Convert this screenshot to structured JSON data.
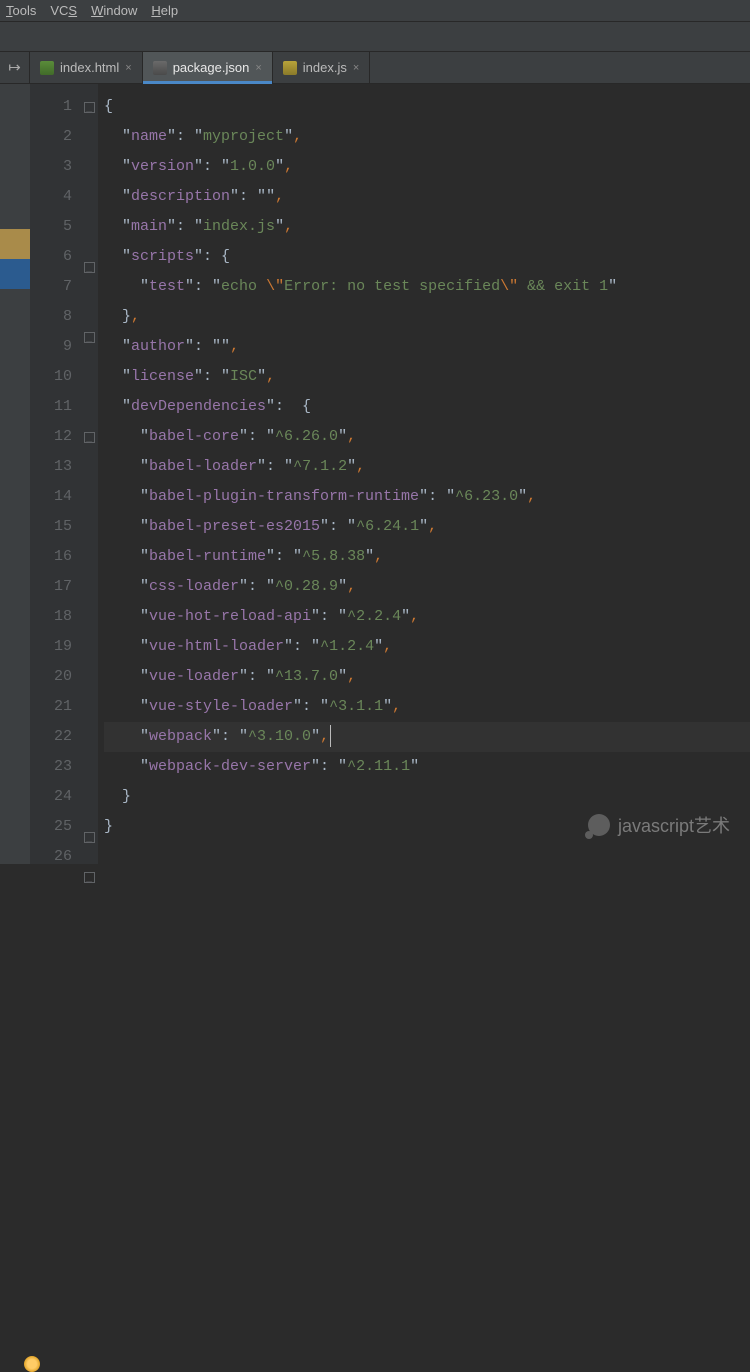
{
  "menu": {
    "items": [
      "Tools",
      "VCS",
      "Window",
      "Help"
    ],
    "underlines": [
      "T",
      "S",
      "W",
      "H"
    ]
  },
  "tabs": [
    {
      "label": "index.html",
      "icon": "html"
    },
    {
      "label": "package.json",
      "icon": "json",
      "active": true
    },
    {
      "label": "index.js",
      "icon": "js"
    }
  ],
  "close_glyph": "×",
  "back_glyph": "↦",
  "watermark": "javascript艺术",
  "code_lines": [
    {
      "n": 1,
      "tokens": [
        [
          "b",
          "{"
        ]
      ],
      "fold": "open"
    },
    {
      "n": 2,
      "tokens": [
        [
          "b",
          "  \""
        ],
        [
          "k",
          "name"
        ],
        [
          "b",
          "\": \""
        ],
        [
          "s",
          "myproject"
        ],
        [
          "b",
          "\""
        ],
        [
          "p",
          ","
        ]
      ]
    },
    {
      "n": 3,
      "tokens": [
        [
          "b",
          "  \""
        ],
        [
          "k",
          "version"
        ],
        [
          "b",
          "\": \""
        ],
        [
          "s",
          "1.0.0"
        ],
        [
          "b",
          "\""
        ],
        [
          "p",
          ","
        ]
      ]
    },
    {
      "n": 4,
      "tokens": [
        [
          "b",
          "  \""
        ],
        [
          "k",
          "description"
        ],
        [
          "b",
          "\": \""
        ],
        [
          "s",
          ""
        ],
        [
          "b",
          "\""
        ],
        [
          "p",
          ","
        ]
      ]
    },
    {
      "n": 5,
      "tokens": [
        [
          "b",
          "  \""
        ],
        [
          "k",
          "main"
        ],
        [
          "b",
          "\": \""
        ],
        [
          "s",
          "index.js"
        ],
        [
          "b",
          "\""
        ],
        [
          "p",
          ","
        ]
      ]
    },
    {
      "n": 6,
      "tokens": [
        [
          "b",
          "  \""
        ],
        [
          "k",
          "scripts"
        ],
        [
          "b",
          "\": {"
        ]
      ],
      "fold": "open"
    },
    {
      "n": 7,
      "tokens": [
        [
          "b",
          "    \""
        ],
        [
          "k",
          "test"
        ],
        [
          "b",
          "\": \""
        ],
        [
          "s",
          "echo "
        ],
        [
          "esc",
          "\\\""
        ],
        [
          "s",
          "Error: no test specified"
        ],
        [
          "esc",
          "\\\""
        ],
        [
          "s",
          " && exit 1"
        ],
        [
          "b",
          "\""
        ]
      ]
    },
    {
      "n": 8,
      "tokens": [
        [
          "b",
          "  }"
        ],
        [
          "p",
          ","
        ]
      ],
      "fold": "close"
    },
    {
      "n": 9,
      "tokens": [
        [
          "b",
          "  \""
        ],
        [
          "k",
          "author"
        ],
        [
          "b",
          "\": \""
        ],
        [
          "s",
          ""
        ],
        [
          "b",
          "\""
        ],
        [
          "p",
          ","
        ]
      ]
    },
    {
      "n": 10,
      "tokens": [
        [
          "b",
          "  \""
        ],
        [
          "k",
          "license"
        ],
        [
          "b",
          "\": \""
        ],
        [
          "s",
          "ISC"
        ],
        [
          "b",
          "\""
        ],
        [
          "p",
          ","
        ]
      ]
    },
    {
      "n": 11,
      "tokens": [
        [
          "b",
          "  \""
        ],
        [
          "k",
          "devDependencies"
        ],
        [
          "b",
          "\":  {"
        ]
      ],
      "fold": "open"
    },
    {
      "n": 12,
      "tokens": [
        [
          "b",
          "    \""
        ],
        [
          "k",
          "babel-core"
        ],
        [
          "b",
          "\": \""
        ],
        [
          "s",
          "^6.26.0"
        ],
        [
          "b",
          "\""
        ],
        [
          "p",
          ","
        ]
      ]
    },
    {
      "n": 13,
      "tokens": [
        [
          "b",
          "    \""
        ],
        [
          "k",
          "babel-loader"
        ],
        [
          "b",
          "\": \""
        ],
        [
          "s",
          "^7.1.2"
        ],
        [
          "b",
          "\""
        ],
        [
          "p",
          ","
        ]
      ]
    },
    {
      "n": 14,
      "tokens": [
        [
          "b",
          "    \""
        ],
        [
          "k",
          "babel-plugin-transform-runtime"
        ],
        [
          "b",
          "\": \""
        ],
        [
          "s",
          "^6.23.0"
        ],
        [
          "b",
          "\""
        ],
        [
          "p",
          ","
        ]
      ]
    },
    {
      "n": 15,
      "tokens": [
        [
          "b",
          "    \""
        ],
        [
          "k",
          "babel-preset-es2015"
        ],
        [
          "b",
          "\": \""
        ],
        [
          "s",
          "^6.24.1"
        ],
        [
          "b",
          "\""
        ],
        [
          "p",
          ","
        ]
      ]
    },
    {
      "n": 16,
      "tokens": [
        [
          "b",
          "    \""
        ],
        [
          "k",
          "babel-runtime"
        ],
        [
          "b",
          "\": \""
        ],
        [
          "s",
          "^5.8.38"
        ],
        [
          "b",
          "\""
        ],
        [
          "p",
          ","
        ]
      ]
    },
    {
      "n": 17,
      "tokens": [
        [
          "b",
          "    \""
        ],
        [
          "k",
          "css-loader"
        ],
        [
          "b",
          "\": \""
        ],
        [
          "s",
          "^0.28.9"
        ],
        [
          "b",
          "\""
        ],
        [
          "p",
          ","
        ]
      ]
    },
    {
      "n": 18,
      "tokens": [
        [
          "b",
          "    \""
        ],
        [
          "k",
          "vue-hot-reload-api"
        ],
        [
          "b",
          "\": \""
        ],
        [
          "s",
          "^2.2.4"
        ],
        [
          "b",
          "\""
        ],
        [
          "p",
          ","
        ]
      ]
    },
    {
      "n": 19,
      "tokens": [
        [
          "b",
          "    \""
        ],
        [
          "k",
          "vue-html-loader"
        ],
        [
          "b",
          "\": \""
        ],
        [
          "s",
          "^1.2.4"
        ],
        [
          "b",
          "\""
        ],
        [
          "p",
          ","
        ]
      ]
    },
    {
      "n": 20,
      "tokens": [
        [
          "b",
          "    \""
        ],
        [
          "k",
          "vue-loader"
        ],
        [
          "b",
          "\": \""
        ],
        [
          "s",
          "^13.7.0"
        ],
        [
          "b",
          "\""
        ],
        [
          "p",
          ","
        ]
      ]
    },
    {
      "n": 21,
      "tokens": [
        [
          "b",
          "    \""
        ],
        [
          "k",
          "vue-style-loader"
        ],
        [
          "b",
          "\": \""
        ],
        [
          "s",
          "^3.1.1"
        ],
        [
          "b",
          "\""
        ],
        [
          "p",
          ","
        ]
      ]
    },
    {
      "n": 22,
      "tokens": [
        [
          "b",
          "    \""
        ],
        [
          "k",
          "webpack"
        ],
        [
          "b",
          "\": \""
        ],
        [
          "s",
          "^3.10.0"
        ],
        [
          "b",
          "\""
        ],
        [
          "p",
          ","
        ]
      ],
      "hl": true,
      "bulb": true,
      "caret": true
    },
    {
      "n": 23,
      "tokens": [
        [
          "b",
          "    \""
        ],
        [
          "k",
          "webpack-dev-server"
        ],
        [
          "b",
          "\": \""
        ],
        [
          "s",
          "^2.11.1"
        ],
        [
          "b",
          "\""
        ]
      ]
    },
    {
      "n": 24,
      "tokens": [
        [
          "b",
          "  }"
        ]
      ],
      "fold": "close"
    },
    {
      "n": 25,
      "tokens": [
        [
          "b",
          "}"
        ]
      ],
      "fold": "close"
    },
    {
      "n": 26,
      "tokens": []
    }
  ]
}
